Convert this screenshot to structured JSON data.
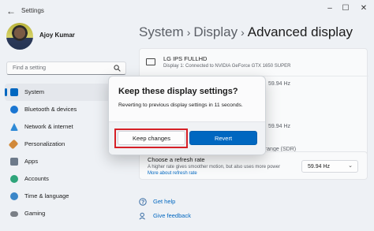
{
  "window": {
    "app_title": "Settings",
    "back_glyph": "←",
    "controls": [
      "–",
      "☐",
      "✕"
    ]
  },
  "sidebar": {
    "user_name": "Ajoy Kumar",
    "search_placeholder": "Find a setting",
    "items": [
      {
        "label": "System",
        "icon": "system-icon",
        "color": "#0067c0",
        "active": true
      },
      {
        "label": "Bluetooth & devices",
        "icon": "bluetooth-icon",
        "color": "#1a76d2",
        "active": false
      },
      {
        "label": "Network & internet",
        "icon": "network-icon",
        "color": "#2f8ad6",
        "active": false
      },
      {
        "label": "Personalization",
        "icon": "brush-icon",
        "color": "#d1893a",
        "active": false
      },
      {
        "label": "Apps",
        "icon": "apps-icon",
        "color": "#6d7a8a",
        "active": false
      },
      {
        "label": "Accounts",
        "icon": "accounts-icon",
        "color": "#2ea47a",
        "active": false
      },
      {
        "label": "Time & language",
        "icon": "globe-icon",
        "color": "#3a86c8",
        "active": false
      },
      {
        "label": "Gaming",
        "icon": "gaming-icon",
        "color": "#7a7f86",
        "active": false
      }
    ]
  },
  "main": {
    "breadcrumb": [
      "System",
      "Display",
      "Advanced display"
    ],
    "breadcrumb_sep": "›",
    "monitor": {
      "name": "LG IPS FULLHD",
      "subtitle": "Display 1: Connected to NVIDIA GeForce GTX 1650 SUPER",
      "bg_values": [
        "59.94 Hz",
        "59.94 Hz",
        "mic range (SDR)"
      ]
    },
    "refresh": {
      "title": "Choose a refresh rate",
      "subtitle": "A higher rate gives smoother motion, but also uses more power",
      "link": "More about refresh rate",
      "selected": "59.94 Hz"
    },
    "help_links": [
      {
        "label": "Get help",
        "icon": "help-icon"
      },
      {
        "label": "Give feedback",
        "icon": "feedback-icon"
      }
    ]
  },
  "dialog": {
    "title": "Keep these display settings?",
    "message": "Reverting to previous display settings in 11 seconds.",
    "keep_label": "Keep changes",
    "revert_label": "Revert",
    "highlight_color": "#d62027"
  },
  "colors": {
    "accent": "#0067c0",
    "background": "#eef1f5"
  }
}
